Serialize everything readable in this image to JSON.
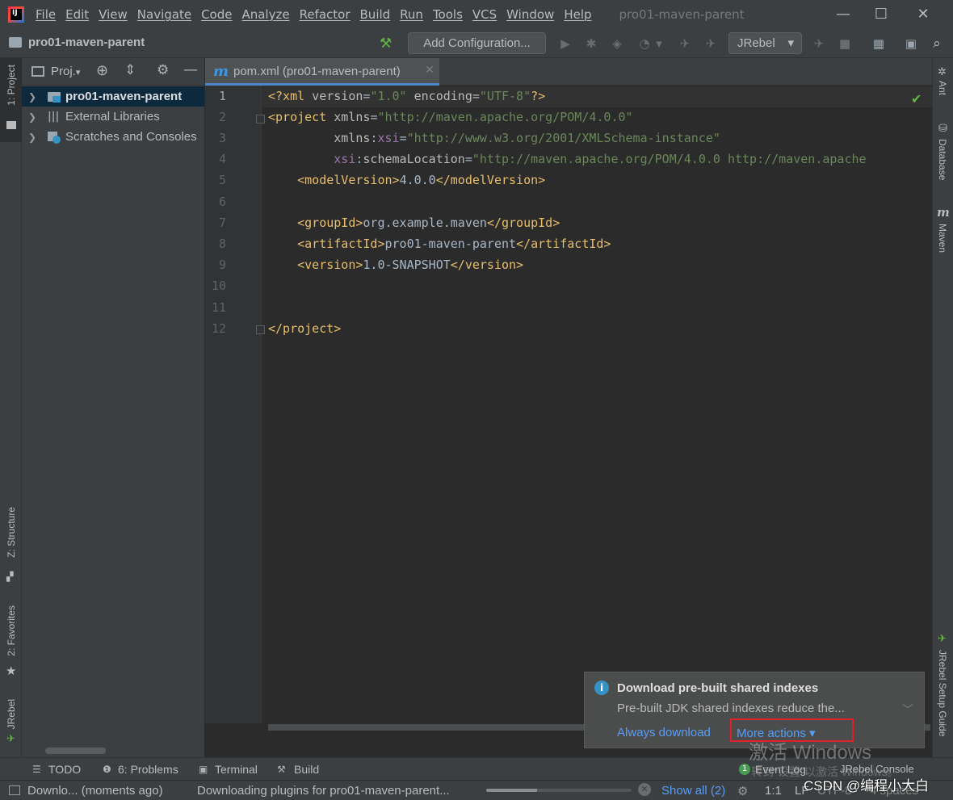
{
  "app": {
    "logo_text": "IJ",
    "window_title": "pro01-maven-parent"
  },
  "menu": [
    "File",
    "Edit",
    "View",
    "Navigate",
    "Code",
    "Analyze",
    "Refactor",
    "Build",
    "Run",
    "Tools",
    "VCS",
    "Window",
    "Help"
  ],
  "window_controls": {
    "minimize": "—",
    "maximize": "☐",
    "close": "✕"
  },
  "navbar": {
    "project_name": "pro01-maven-parent",
    "add_configuration": "Add Configuration...",
    "jrebel_select": "JRebel"
  },
  "left_strip": {
    "project": "1: Project",
    "structure": "Z: Structure",
    "favorites": "2: Favorites",
    "jrebel": "JRebel"
  },
  "right_strip": {
    "ant": "Ant",
    "database": "Database",
    "maven": "Maven",
    "jrebel_setup": "JRebel Setup Guide"
  },
  "project_panel": {
    "title": "Proj.",
    "tree": [
      {
        "label": "pro01-maven-parent",
        "selected": true,
        "icon": "module-folder-icon"
      },
      {
        "label": "External Libraries",
        "selected": false,
        "icon": "library-icon"
      },
      {
        "label": "Scratches and Consoles",
        "selected": false,
        "icon": "scratch-icon"
      }
    ]
  },
  "editor": {
    "tab_label": "pom.xml (pro01-maven-parent)",
    "tab_icon_letter": "m",
    "line_numbers": [
      "1",
      "2",
      "3",
      "4",
      "5",
      "6",
      "7",
      "8",
      "9",
      "10",
      "11",
      "12"
    ],
    "current_line": 1,
    "code": {
      "l1": {
        "decl_open": "<?xml",
        "version_attr": " version",
        "version_eq": "=",
        "version_val": "\"1.0\"",
        "enc_attr": " encoding",
        "enc_eq": "=",
        "enc_val": "\"UTF-8\"",
        "decl_close": "?>"
      },
      "l2": {
        "tag_open": "<project",
        "attr": " xmlns",
        "eq": "=",
        "val": "\"http://maven.apache.org/POM/4.0.0\""
      },
      "l3": {
        "indent": "         ",
        "attr": "xmlns",
        "colon": ":",
        "ns": "xsi",
        "eq": "=",
        "val": "\"http://www.w3.org/2001/XMLSchema-instance\""
      },
      "l4": {
        "indent": "         ",
        "ns": "xsi",
        "colon": ":",
        "attr": "schemaLocation",
        "eq": "=",
        "val": "\"http://maven.apache.org/POM/4.0.0 http://maven.apache"
      },
      "l5": {
        "indent": "    ",
        "open": "<modelVersion>",
        "text": "4.0.0",
        "close": "</modelVersion>"
      },
      "l7": {
        "indent": "    ",
        "open": "<groupId>",
        "text": "org.example.maven",
        "close": "</groupId>"
      },
      "l8": {
        "indent": "    ",
        "open": "<artifactId>",
        "text": "pro01-maven-parent",
        "close": "</artifactId>"
      },
      "l9": {
        "indent": "    ",
        "open": "<version>",
        "text": "1.0-SNAPSHOT",
        "close": "</version>"
      },
      "l12": {
        "close": "</project>"
      }
    }
  },
  "notification": {
    "title": "Download pre-built shared indexes",
    "body": "Pre-built JDK shared indexes reduce the...",
    "action_always": "Always download",
    "action_more": "More actions ▾"
  },
  "watermark": {
    "line1": "激活 Windows",
    "line2": "转到\"设置\"以激活 Windows。",
    "csdn": "CSDN @编程小大白"
  },
  "bottom_tools": {
    "todo": "TODO",
    "problems": "6: Problems",
    "terminal": "Terminal",
    "build": "Build",
    "event_log": "Event Log",
    "event_count": "1",
    "jrebel_console": "JRebel Console"
  },
  "status": {
    "left_msg": "Downlo... (moments ago)",
    "task": "Downloading plugins for pro01-maven-parent...",
    "progress": 0.35,
    "show_all": "Show all (2)",
    "position": "1:1",
    "line_sep": "LF",
    "encoding": "UTF-8",
    "indent": "4 spaces"
  },
  "colors": {
    "accent": "#4a88c7",
    "link": "#589df6",
    "highlight_box": "#e0202a",
    "success": "#62b543"
  }
}
